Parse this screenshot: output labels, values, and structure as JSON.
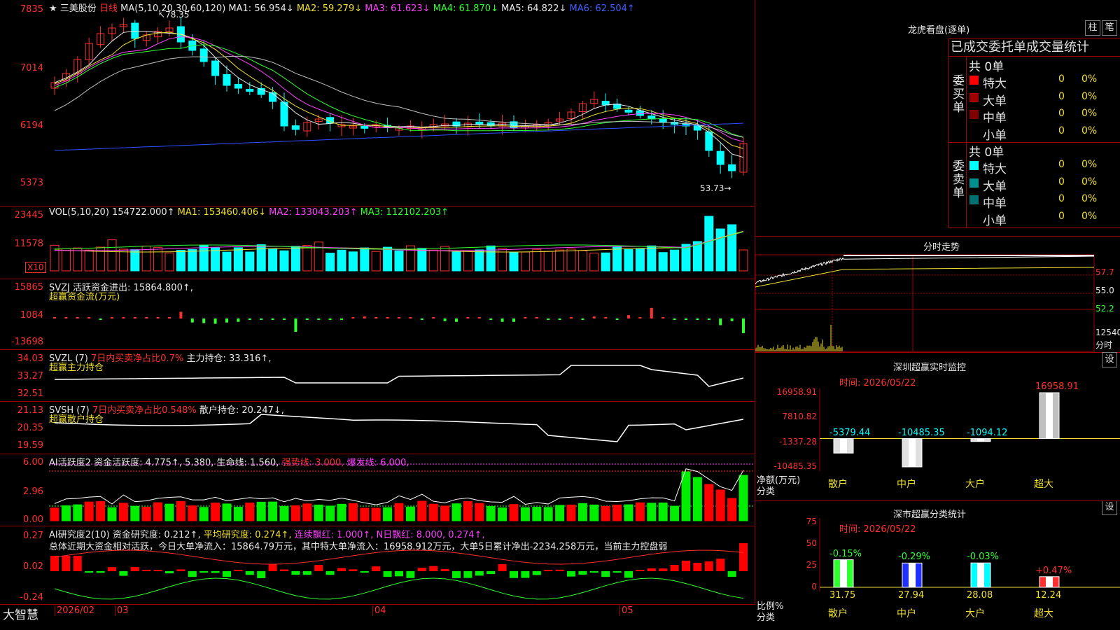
{
  "main_chart": {
    "stock_name": "三美股份",
    "period": "日线",
    "ma_title": "MA(5,10,20,30,60,120)",
    "ma1": "MA1: 56.954↓",
    "ma2": "MA2: 59.279↓",
    "ma3": "MA3: 61.623↓",
    "ma4": "MA4: 61.870↓",
    "ma5": "MA5: 64.822↓",
    "ma6": "MA6: 62.504↑",
    "y_labels": [
      "7835",
      "7014",
      "6194",
      "5373"
    ],
    "high_mark": "78.35",
    "low_mark": "53.73"
  },
  "volume_panel": {
    "title": "VOL(5,10,20)",
    "value": "154722.000↑",
    "ma1": "MA1: 153460.406↓",
    "ma2": "MA2: 133043.203↑",
    "ma3": "MA3: 112102.203↑",
    "y_labels": [
      "23445",
      "11578"
    ],
    "unit": "X10"
  },
  "svzj_panel": {
    "title": "SVZJ",
    "label": "活跃资金进出: 15864.800↑,",
    "subtitle": "超赢资金流(万元)",
    "y_labels": [
      "15865",
      "1084",
      "-13698"
    ]
  },
  "svzl_panel": {
    "title": "SVZL (7)",
    "label_red": "7日内买卖净占比0.7%",
    "label_white": "主力持仓: 33.316↑,",
    "subtitle": "超赢主力持仓",
    "y_labels": [
      "34.03",
      "33.27",
      "32.51"
    ]
  },
  "svsh_panel": {
    "title": "SVSH (7)",
    "label_red": "7日内买卖净占比0.548%",
    "label_white": "散户持仓: 20.247↓,",
    "subtitle": "超赢散户持仓",
    "y_labels": [
      "21.13",
      "20.35",
      "19.59"
    ]
  },
  "ai_activity_panel": {
    "title": "AI活跃度2",
    "label_a": "资金活跃度: 4.775↑,",
    "label_b": "5.380,",
    "label_c": "生命线: 1.560,",
    "label_d": "强势线: 3.000,",
    "label_e": "爆发线: 6.000,",
    "y_labels": [
      "6.00",
      "2.96",
      "0.00"
    ]
  },
  "ai_research_panel": {
    "title": "AI研究度2(10)",
    "label_a": "资金研究度: 0.212↑,",
    "label_b": "平均研究度: 0.274↑,",
    "label_c": "连续飘红: 1.000↑,",
    "label_d": "N日飘红: 8.000,",
    "label_e": "0.274↑,",
    "summary": "总体近期大资金相对活跃，今日大单净流入：15864.79万元，其中特大单净流入：16958.912万元，大单5日累计净出-2234.258万元，当前主力控盘弱",
    "y_labels": [
      "0.27",
      "0.02",
      "-0.24"
    ]
  },
  "x_axis": {
    "app_name": "大智慧",
    "labels": [
      "2026/02",
      "03",
      "04",
      "05"
    ]
  },
  "right_panel": {
    "dragon_title": "龙虎看盘(逐单)",
    "btn_zhu": "柱",
    "btn_bi": "笔",
    "tabs_title": "已成交委托单成交量统计",
    "buy_side": {
      "label": "委买单",
      "total": "共 0单",
      "rows": [
        {
          "name": "特大",
          "count": "0",
          "pct": "0%",
          "color": "#ff0000"
        },
        {
          "name": "大单",
          "count": "0",
          "pct": "0%",
          "color": "#a00000"
        },
        {
          "name": "中单",
          "count": "0",
          "pct": "0%",
          "color": "#800000"
        },
        {
          "name": "小单",
          "count": "0",
          "pct": "0%",
          "color": "#000000"
        }
      ]
    },
    "sell_side": {
      "label": "委卖单",
      "total": "共 0单",
      "rows": [
        {
          "name": "特大",
          "count": "0",
          "pct": "0%",
          "color": "#00ffff"
        },
        {
          "name": "大单",
          "count": "0",
          "pct": "0%",
          "color": "#009090"
        },
        {
          "name": "中单",
          "count": "0",
          "pct": "0%",
          "color": "#007070"
        },
        {
          "name": "小单",
          "count": "0",
          "pct": "0%",
          "color": "#000000"
        }
      ]
    },
    "intraday": {
      "title": "分时走势",
      "y_labels": [
        "57.7",
        "55.0",
        "52.2"
      ],
      "vol_label": "12540",
      "vol_sub": "分时"
    },
    "sz_monitor": {
      "title": "深圳超赢实时监控",
      "btn": "设",
      "time": "时间: 2026/05/22",
      "y_labels": [
        "16958.91",
        "7810.82",
        "-1337.28",
        "-10485.35"
      ],
      "axis_title": "净额(万元)",
      "axis_sub": "分类",
      "chart_data": {
        "type": "bar",
        "categories": [
          "散户",
          "中户",
          "大户",
          "超大"
        ],
        "values": [
          -5379.44,
          -10485.35,
          -1094.12,
          16958.91
        ],
        "value_labels": [
          "-5379.44",
          "-10485.35",
          "-1094.12",
          "16958.91"
        ],
        "ylim": [
          -10485.35,
          16958.91
        ]
      }
    },
    "sz_category": {
      "title": "深市超赢分类统计",
      "btn": "设",
      "time": "时间: 2026/05/22",
      "y_labels": [
        "75",
        "50",
        "25",
        "0"
      ],
      "axis_title": "比例%",
      "axis_sub": "分类",
      "chart_data": {
        "type": "bar",
        "categories": [
          "散户",
          "中户",
          "大户",
          "超大"
        ],
        "values": [
          31.75,
          27.94,
          28.08,
          12.24
        ],
        "value_labels": [
          "31.75",
          "27.94",
          "28.08",
          "12.24"
        ],
        "changes": [
          "-0.15%",
          "-0.29%",
          "-0.03%",
          "+0.47%"
        ],
        "ylim": [
          0,
          75
        ]
      }
    }
  },
  "colors": {
    "up": "#ff3030",
    "down": "#00ffff",
    "grid": "#a00000"
  }
}
